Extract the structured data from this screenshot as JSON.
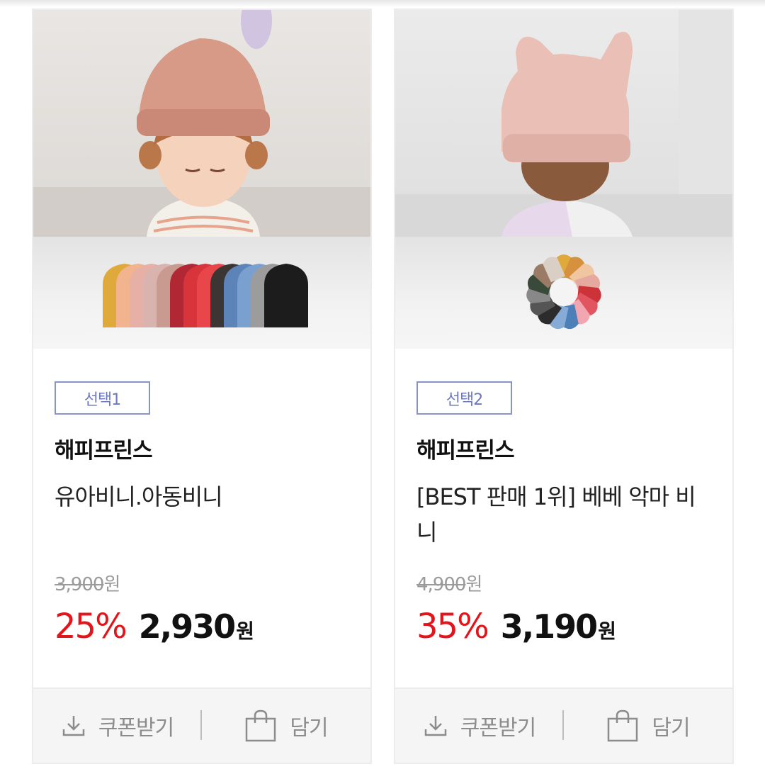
{
  "products": [
    {
      "option_label": "선택1",
      "brand": "해피프린스",
      "name": "유아비니.아동비니",
      "original_price": "3,900",
      "original_unit": "원",
      "discount": "25%",
      "price": "2,930",
      "price_unit": "원",
      "coupon_label": "쿠폰받기",
      "cart_label": "담기",
      "photo_hat_color": "#d79a86",
      "swatches": [
        "#e0a93b",
        "#f1b48e",
        "#e6b0a6",
        "#d9b3ad",
        "#c99a8f",
        "#b12834",
        "#d8343c",
        "#e9464c",
        "#3b3533",
        "#5d84b8",
        "#7aa0d0",
        "#9c9c9c",
        "#1c1c1c"
      ]
    },
    {
      "option_label": "선택2",
      "brand": "해피프린스",
      "name": "[BEST 판매 1위] 베베 악마 비니",
      "original_price": "4,900",
      "original_unit": "원",
      "discount": "35%",
      "price": "3,190",
      "price_unit": "원",
      "coupon_label": "쿠폰받기",
      "cart_label": "담기",
      "photo_hat_color": "#eac0b6",
      "swatches": [
        "#e0a93b",
        "#d6913f",
        "#f0c6a0",
        "#e6a9a0",
        "#cc3339",
        "#e05560",
        "#f2a6b2",
        "#4d7fb8",
        "#86abd6",
        "#2c2c2c",
        "#555555",
        "#888888",
        "#3a4a3a",
        "#9c7b66",
        "#d9cfc4"
      ]
    }
  ],
  "colors": {
    "discount": "#e3141b",
    "badge_border": "#8a93c9",
    "badge_text": "#6e78bd"
  },
  "icons": {
    "coupon": "download-icon",
    "cart": "shopping-bag-icon"
  }
}
